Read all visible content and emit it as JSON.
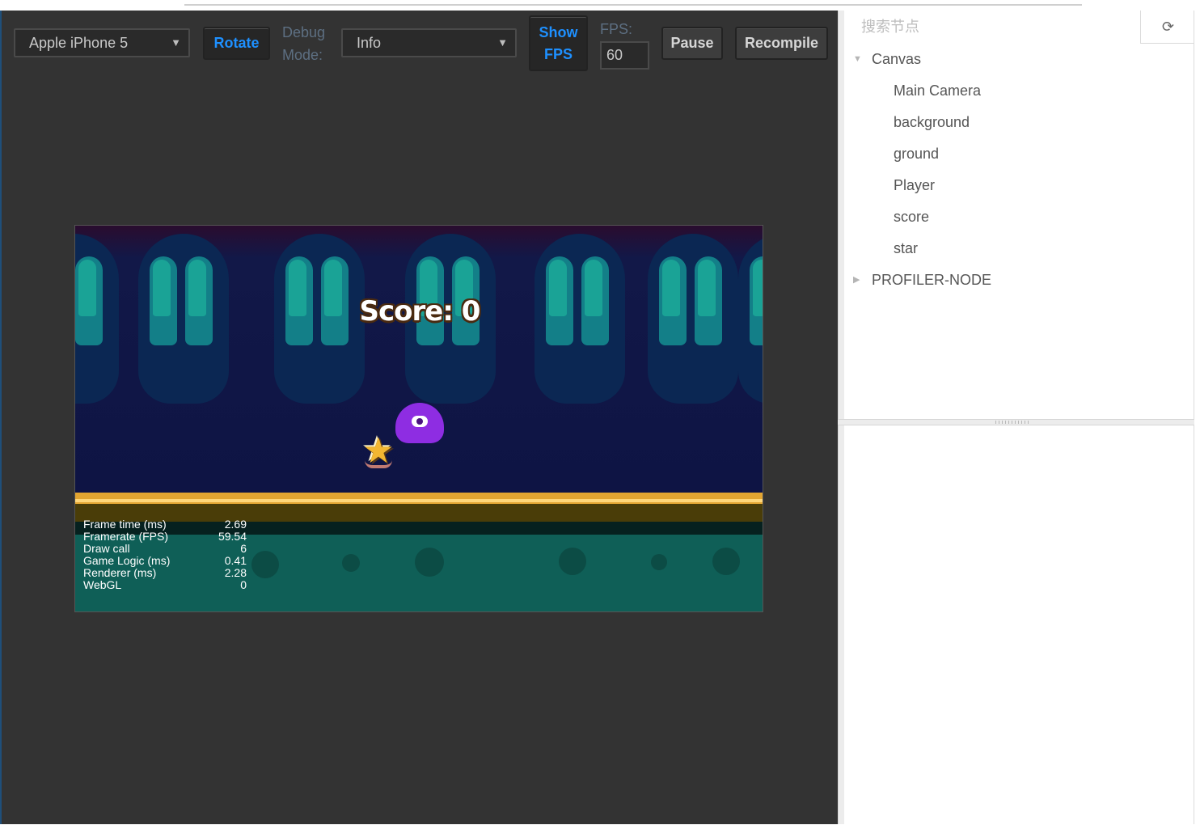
{
  "toolbar": {
    "device": "Apple iPhone 5",
    "rotate_label": "Rotate",
    "debug_mode_label_line1": "Debug",
    "debug_mode_label_line2": "Mode:",
    "debug_mode_value": "Info",
    "show_fps_line1": "Show",
    "show_fps_line2": "FPS",
    "fps_label": "FPS:",
    "fps_value": "60",
    "pause_label": "Pause",
    "recompile_label": "Recompile"
  },
  "game": {
    "score_text": "Score: 0",
    "stats": [
      {
        "label": "Frame time (ms)",
        "value": "2.69"
      },
      {
        "label": "Framerate (FPS)",
        "value": "59.54"
      },
      {
        "label": "Draw call",
        "value": "6"
      },
      {
        "label": "Game Logic (ms)",
        "value": "0.41"
      },
      {
        "label": "Renderer (ms)",
        "value": "2.28"
      },
      {
        "label": "WebGL",
        "value": "0"
      }
    ]
  },
  "node_tree": {
    "search_placeholder": "搜索节点",
    "refresh_icon": "refresh-icon",
    "root": {
      "label": "Canvas",
      "expanded": true
    },
    "children": [
      "Main Camera",
      "background",
      "ground",
      "Player",
      "score",
      "star"
    ],
    "profiler": {
      "label": "PROFILER-NODE",
      "expanded": false
    }
  },
  "colors": {
    "active_button_text": "#1e90ff",
    "preview_bg": "#333333",
    "player": "#8e2de2",
    "ground": "#e2a531"
  }
}
